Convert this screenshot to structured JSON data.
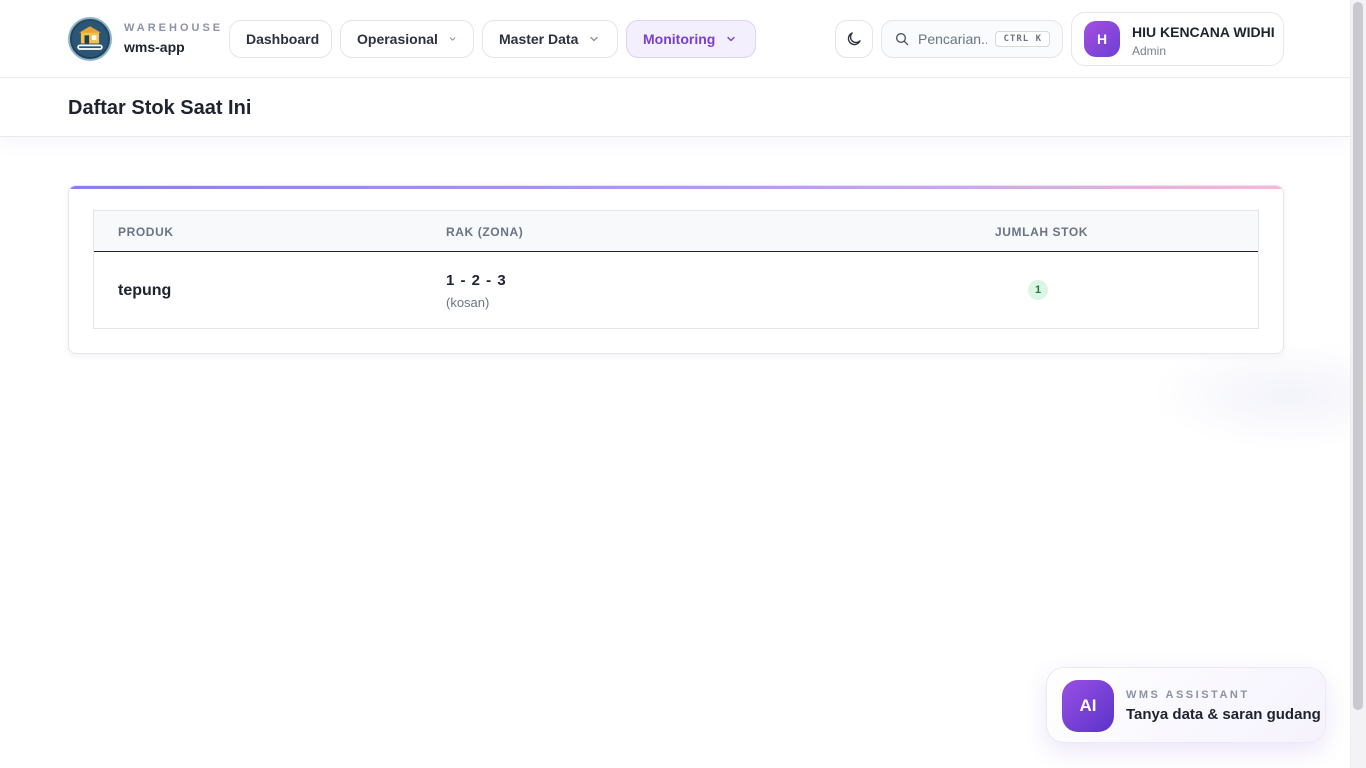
{
  "brand": {
    "kicker": "WAREHOUSE",
    "name": "wms-app",
    "logo_icon": "warehouse-logo-icon"
  },
  "nav": {
    "items": [
      {
        "label": "Dashboard",
        "has_dropdown": false,
        "active": false
      },
      {
        "label": "Operasional",
        "has_dropdown": true,
        "active": false
      },
      {
        "label": "Master Data",
        "has_dropdown": true,
        "active": false
      },
      {
        "label": "Monitoring",
        "has_dropdown": true,
        "active": true
      }
    ]
  },
  "theme_toggle": {
    "icon": "moon-icon"
  },
  "search": {
    "placeholder": "Pencarian...",
    "shortcut": "CTRL K",
    "icon": "search-icon"
  },
  "user": {
    "initial": "H",
    "name": "HIU KENCANA WIDHI",
    "role": "Admin"
  },
  "page": {
    "title": "Daftar Stok Saat Ini"
  },
  "stock_table": {
    "columns": [
      "PRODUK",
      "RAK (ZONA)",
      "JUMLAH STOK"
    ],
    "rows": [
      {
        "product": "tepung",
        "rack": "1 - 2 - 3",
        "zone": "(kosan)",
        "quantity": "1"
      }
    ]
  },
  "assistant": {
    "badge": "AI",
    "kicker": "WMS ASSISTANT",
    "text": "Tanya data & saran gudang"
  },
  "colors": {
    "accent": "#7a3fd0",
    "accent_bg": "#f3effc",
    "success_bg": "#dcf5e4",
    "success_text": "#1d7a43"
  }
}
